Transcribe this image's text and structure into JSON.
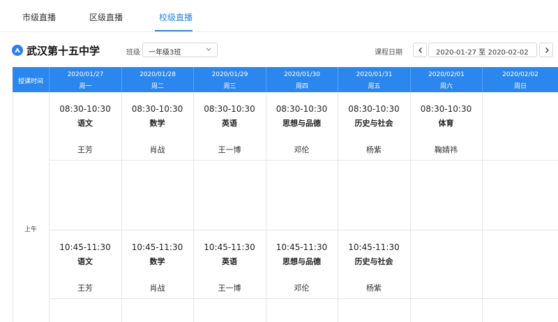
{
  "tabs": [
    {
      "label": "市级直播"
    },
    {
      "label": "区级直播"
    },
    {
      "label": "校级直播",
      "active": true
    }
  ],
  "colors": {
    "accent": "#2b86ed",
    "header_text": "#ffffff"
  },
  "school": {
    "name": "武汉第十五中学",
    "icon": "school-logo-icon"
  },
  "filters": {
    "class_label": "班级",
    "class_value": "一年级3班",
    "date_label": "课程日期",
    "date_range": "2020-01-27  至 2020-02-02"
  },
  "table": {
    "time_header": "授课时间",
    "days": [
      {
        "date": "2020/01/27",
        "weekday": "周一"
      },
      {
        "date": "2020/01/28",
        "weekday": "周二"
      },
      {
        "date": "2020/01/29",
        "weekday": "周三"
      },
      {
        "date": "2020/01/30",
        "weekday": "周四"
      },
      {
        "date": "2020/01/31",
        "weekday": "周五"
      },
      {
        "date": "2020/02/01",
        "weekday": "周六"
      },
      {
        "date": "2020/02/02",
        "weekday": "周日"
      }
    ],
    "period": "上午",
    "slot1": [
      {
        "time": "08:30-10:30",
        "subject": "语文",
        "teacher": "王芳"
      },
      {
        "time": "08:30-10:30",
        "subject": "数学",
        "teacher": "肖战"
      },
      {
        "time": "08:30-10:30",
        "subject": "英语",
        "teacher": "王一博"
      },
      {
        "time": "08:30-10:30",
        "subject": "思想与品德",
        "teacher": "邓伦"
      },
      {
        "time": "08:30-10:30",
        "subject": "历史与社会",
        "teacher": "杨紫"
      },
      {
        "time": "08:30-10:30",
        "subject": "体育",
        "teacher": "鞠婧祎"
      }
    ],
    "slot2": [
      {
        "time": "10:45-11:30",
        "subject": "语文",
        "teacher": "王芳"
      },
      {
        "time": "10:45-11:30",
        "subject": "数学",
        "teacher": "肖战"
      },
      {
        "time": "10:45-11:30",
        "subject": "英语",
        "teacher": "王一博"
      },
      {
        "time": "10:45-11:30",
        "subject": "思想与品德",
        "teacher": "邓伦"
      },
      {
        "time": "10:45-11:30",
        "subject": "历史与社会",
        "teacher": "杨紫"
      }
    ]
  }
}
